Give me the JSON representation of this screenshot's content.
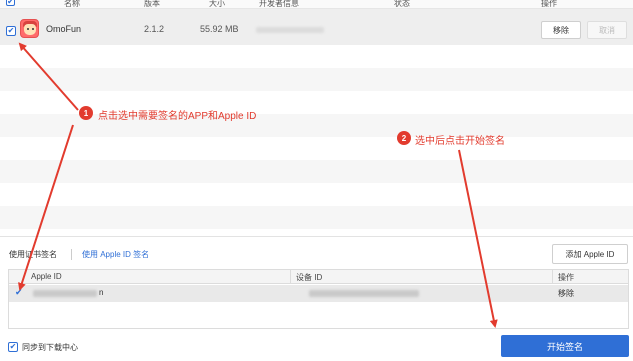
{
  "app_table": {
    "columns": [
      "名称",
      "版本",
      "大小",
      "开发者信息",
      "状态",
      "操作"
    ],
    "row": {
      "checked": true,
      "name": "OmoFun",
      "version": "2.1.2",
      "size": "55.92 MB",
      "remove_label": "移除",
      "cancel_label": "取消"
    }
  },
  "annotations": {
    "step1_number": "1",
    "step1_text": "点击选中需要签名的APP和Apple ID",
    "step2_number": "2",
    "step2_text": "选中后点击开始签名"
  },
  "sign_panel": {
    "tab_certificate": "使用证书签名",
    "tab_apple_id": "使用 Apple ID 签名",
    "add_apple_id_label": "添加 Apple ID",
    "columns": [
      "Apple ID",
      "设备 ID",
      "操作"
    ],
    "row": {
      "checked": true,
      "apple_id_suffix": "n",
      "remove_label": "移除"
    },
    "sync_checked": true,
    "sync_label": "同步到下载中心",
    "start_label": "开始签名"
  },
  "colors": {
    "accent": "#2f6fd6",
    "annotation": "#e23b2e"
  }
}
